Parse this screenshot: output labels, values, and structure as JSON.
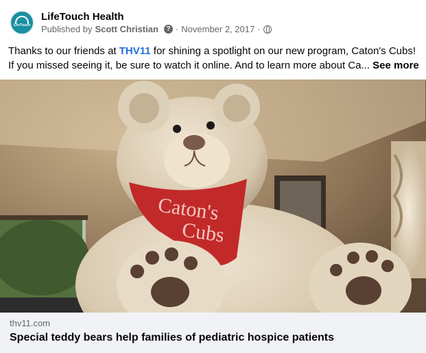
{
  "post": {
    "page_name": "LifeTouch Health",
    "avatar_text": "LifeTouch",
    "published_by_label": "Published by",
    "publisher": "Scott Christian",
    "date": "November 2, 2017",
    "text_before_tag": "Thanks to our friends at ",
    "tag": "THV11",
    "text_after_tag": " for shining a spotlight on our new program, Caton's Cubs! If you missed seeing it, be sure to watch it online. And to learn more about Ca... ",
    "see_more": "See more"
  },
  "media": {
    "bandana_text_line1": "Caton's",
    "bandana_text_line2": "Cubs"
  },
  "link": {
    "domain": "thv11.com",
    "title": "Special teddy bears help families of pediatric hospice patients"
  },
  "icons": {
    "questionmark": "question-icon",
    "globe": "globe-icon"
  }
}
